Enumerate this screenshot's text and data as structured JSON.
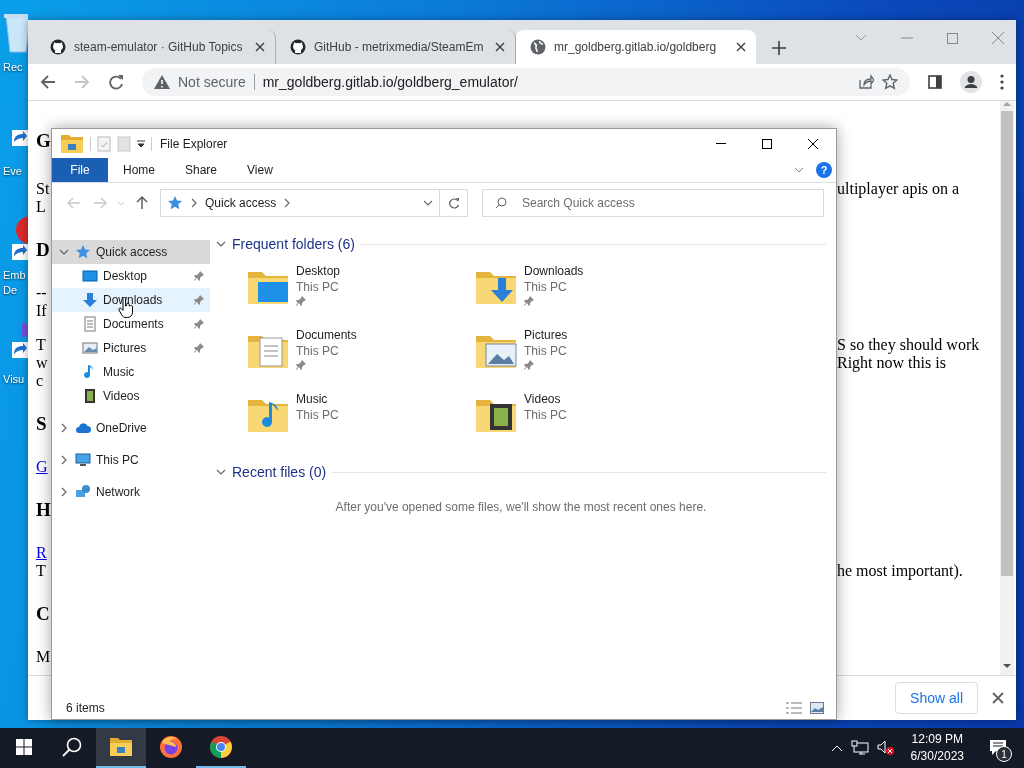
{
  "desktop_icons": [
    {
      "kind": "recycle",
      "lines": [
        "Rec"
      ]
    },
    {
      "kind": "shortcut",
      "lines": [
        "Eve"
      ]
    },
    {
      "kind": "app-round",
      "lines": [
        "Emb",
        "De"
      ]
    },
    {
      "kind": "app-triangle",
      "lines": [
        "Visu"
      ]
    }
  ],
  "browser": {
    "tabs": [
      {
        "title": "steam-emulator · GitHub Topics",
        "kind": "github",
        "selected": false
      },
      {
        "title": "GitHub - metrixmedia/SteamEm",
        "kind": "github",
        "selected": false
      },
      {
        "title": "mr_goldberg.gitlab.io/goldberg",
        "kind": "globe",
        "selected": true
      }
    ],
    "security": "Not secure",
    "url": "mr_goldberg.gitlab.io/goldberg_emulator/",
    "page": [
      {
        "kind": "h1",
        "lines": [
          {
            "left": "G",
            "link": false
          }
        ]
      },
      {
        "kind": "p",
        "lines": [
          {
            "left": "St",
            "right": "ultiplayer apis on a",
            "link": false
          },
          {
            "left": "L",
            "link": false
          }
        ]
      },
      {
        "kind": "h2",
        "lines": [
          {
            "left": "D",
            "link": false
          }
        ]
      },
      {
        "kind": "p",
        "lines": [
          {
            "left": "--",
            "link": false
          },
          {
            "left": "If",
            "link": false
          }
        ]
      },
      {
        "kind": "p",
        "lines": [
          {
            "left": "T",
            "right": "S so they should work",
            "link": false
          },
          {
            "left": "w",
            "right": "Right now this is",
            "link": false
          },
          {
            "left": "c",
            "link": false
          }
        ]
      },
      {
        "kind": "h2",
        "lines": [
          {
            "left": "S",
            "link": false
          }
        ]
      },
      {
        "kind": "p",
        "lines": [
          {
            "left": "G",
            "link": true
          }
        ]
      },
      {
        "kind": "h2",
        "lines": [
          {
            "left": "H",
            "link": false
          }
        ]
      },
      {
        "kind": "p",
        "lines": [
          {
            "left": "R",
            "link": true
          },
          {
            "left": "T",
            "right": "he most important).",
            "link": false
          }
        ]
      },
      {
        "kind": "h2",
        "lines": [
          {
            "left": "C",
            "link": false
          }
        ]
      },
      {
        "kind": "p",
        "lines": [
          {
            "left": "M",
            "link": false
          }
        ]
      }
    ],
    "download_bar": {
      "button": "Show all"
    }
  },
  "explorer": {
    "title": "File Explorer",
    "ribbon_tabs": [
      {
        "label": "File",
        "kind": "file"
      },
      {
        "label": "Home",
        "kind": "tab"
      },
      {
        "label": "Share",
        "kind": "tab"
      },
      {
        "label": "View",
        "kind": "tab"
      }
    ],
    "help": "?",
    "address": {
      "crumbs": [
        "Quick access"
      ]
    },
    "search_placeholder": "Search Quick access",
    "nav": [
      {
        "label": "Quick access",
        "kind": "star",
        "expanded": true,
        "selected": true,
        "hovered": false,
        "children": [
          {
            "label": "Desktop",
            "kind": "desktop",
            "pinned": true,
            "selected": false,
            "hovered": false
          },
          {
            "label": "Downloads",
            "kind": "downloads",
            "pinned": true,
            "selected": false,
            "hovered": true
          },
          {
            "label": "Documents",
            "kind": "documents",
            "pinned": true,
            "selected": false,
            "hovered": false
          },
          {
            "label": "Pictures",
            "kind": "pictures",
            "pinned": true,
            "selected": false,
            "hovered": false
          },
          {
            "label": "Music",
            "kind": "music",
            "pinned": false,
            "selected": false,
            "hovered": false
          },
          {
            "label": "Videos",
            "kind": "videos",
            "pinned": false,
            "selected": false,
            "hovered": false
          }
        ]
      },
      {
        "label": "OneDrive",
        "kind": "cloud",
        "expanded": false,
        "selected": false,
        "hovered": false
      },
      {
        "label": "This PC",
        "kind": "pc",
        "expanded": false,
        "selected": false,
        "hovered": false
      },
      {
        "label": "Network",
        "kind": "network",
        "expanded": false,
        "selected": false,
        "hovered": false
      }
    ],
    "sections": [
      {
        "title": "Frequent folders (6)",
        "expanded": true,
        "folders": [
          {
            "name": "Desktop",
            "location": "This PC",
            "kind": "desktop",
            "pinned": true
          },
          {
            "name": "Downloads",
            "location": "This PC",
            "kind": "downloads",
            "pinned": true
          },
          {
            "name": "Documents",
            "location": "This PC",
            "kind": "documents",
            "pinned": true
          },
          {
            "name": "Pictures",
            "location": "This PC",
            "kind": "pictures",
            "pinned": true
          },
          {
            "name": "Music",
            "location": "This PC",
            "kind": "music",
            "pinned": false
          },
          {
            "name": "Videos",
            "location": "This PC",
            "kind": "videos",
            "pinned": false
          }
        ]
      },
      {
        "title": "Recent files (0)",
        "expanded": true,
        "empty_message": "After you've opened some files, we'll show the most recent ones here."
      }
    ],
    "status": "6 items"
  },
  "taskbar": {
    "apps": [
      {
        "kind": "explorer",
        "running": true,
        "selected": true
      },
      {
        "kind": "firefox",
        "running": false,
        "selected": false
      },
      {
        "kind": "chrome",
        "running": true,
        "selected": false
      }
    ],
    "time": "12:09 PM",
    "date": "6/30/2023",
    "notifications": "1"
  }
}
